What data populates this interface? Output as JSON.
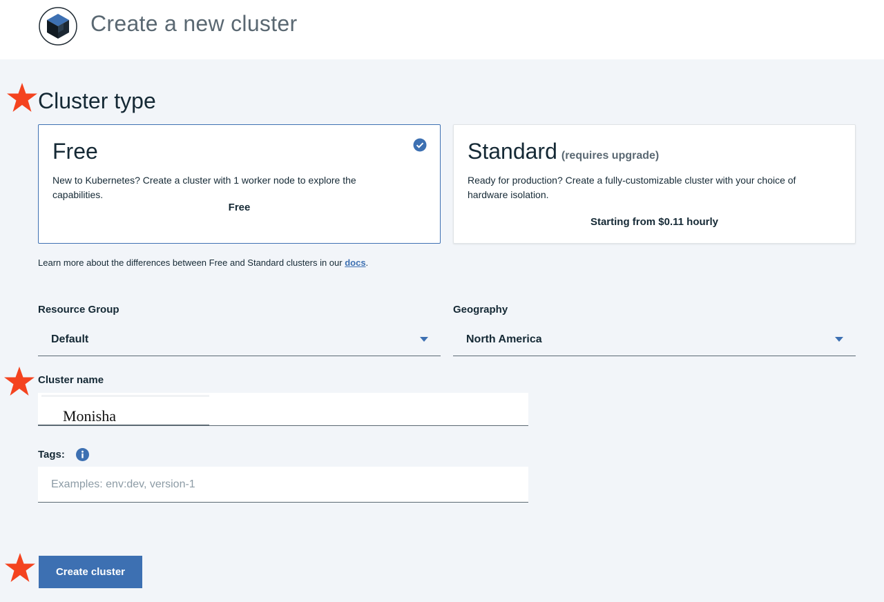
{
  "header": {
    "title": "Create a new cluster",
    "logo_icon": "kubernetes-cube-icon"
  },
  "cluster_type": {
    "heading": "Cluster type",
    "tiles": [
      {
        "title": "Free",
        "note": "",
        "description": "New to Kubernetes? Create a cluster with 1 worker node to explore the capabilities.",
        "price": "Free",
        "selected": true
      },
      {
        "title": "Standard",
        "note": "(requires upgrade)",
        "description": "Ready for production? Create a fully-customizable cluster with your choice of hardware isolation.",
        "price": "Starting from $0.11 hourly",
        "selected": false
      }
    ],
    "learn_more_prefix": "Learn more about the differences between Free and Standard clusters in our ",
    "learn_more_link": "docs",
    "learn_more_suffix": "."
  },
  "form": {
    "resource_group": {
      "label": "Resource Group",
      "value": "Default"
    },
    "geography": {
      "label": "Geography",
      "value": "North America"
    },
    "cluster_name": {
      "label": "Cluster name",
      "value": "Monisha"
    },
    "tags": {
      "label": "Tags:",
      "placeholder": "Examples: env:dev, version-1"
    },
    "submit_label": "Create cluster"
  },
  "colors": {
    "accent": "#3d70b2",
    "star": "#f4431f",
    "page_background": "#f2f5f9"
  },
  "icons": [
    "kubernetes-cube-icon",
    "checkmark-icon",
    "chevron-down-icon",
    "info-icon",
    "star-icon"
  ]
}
